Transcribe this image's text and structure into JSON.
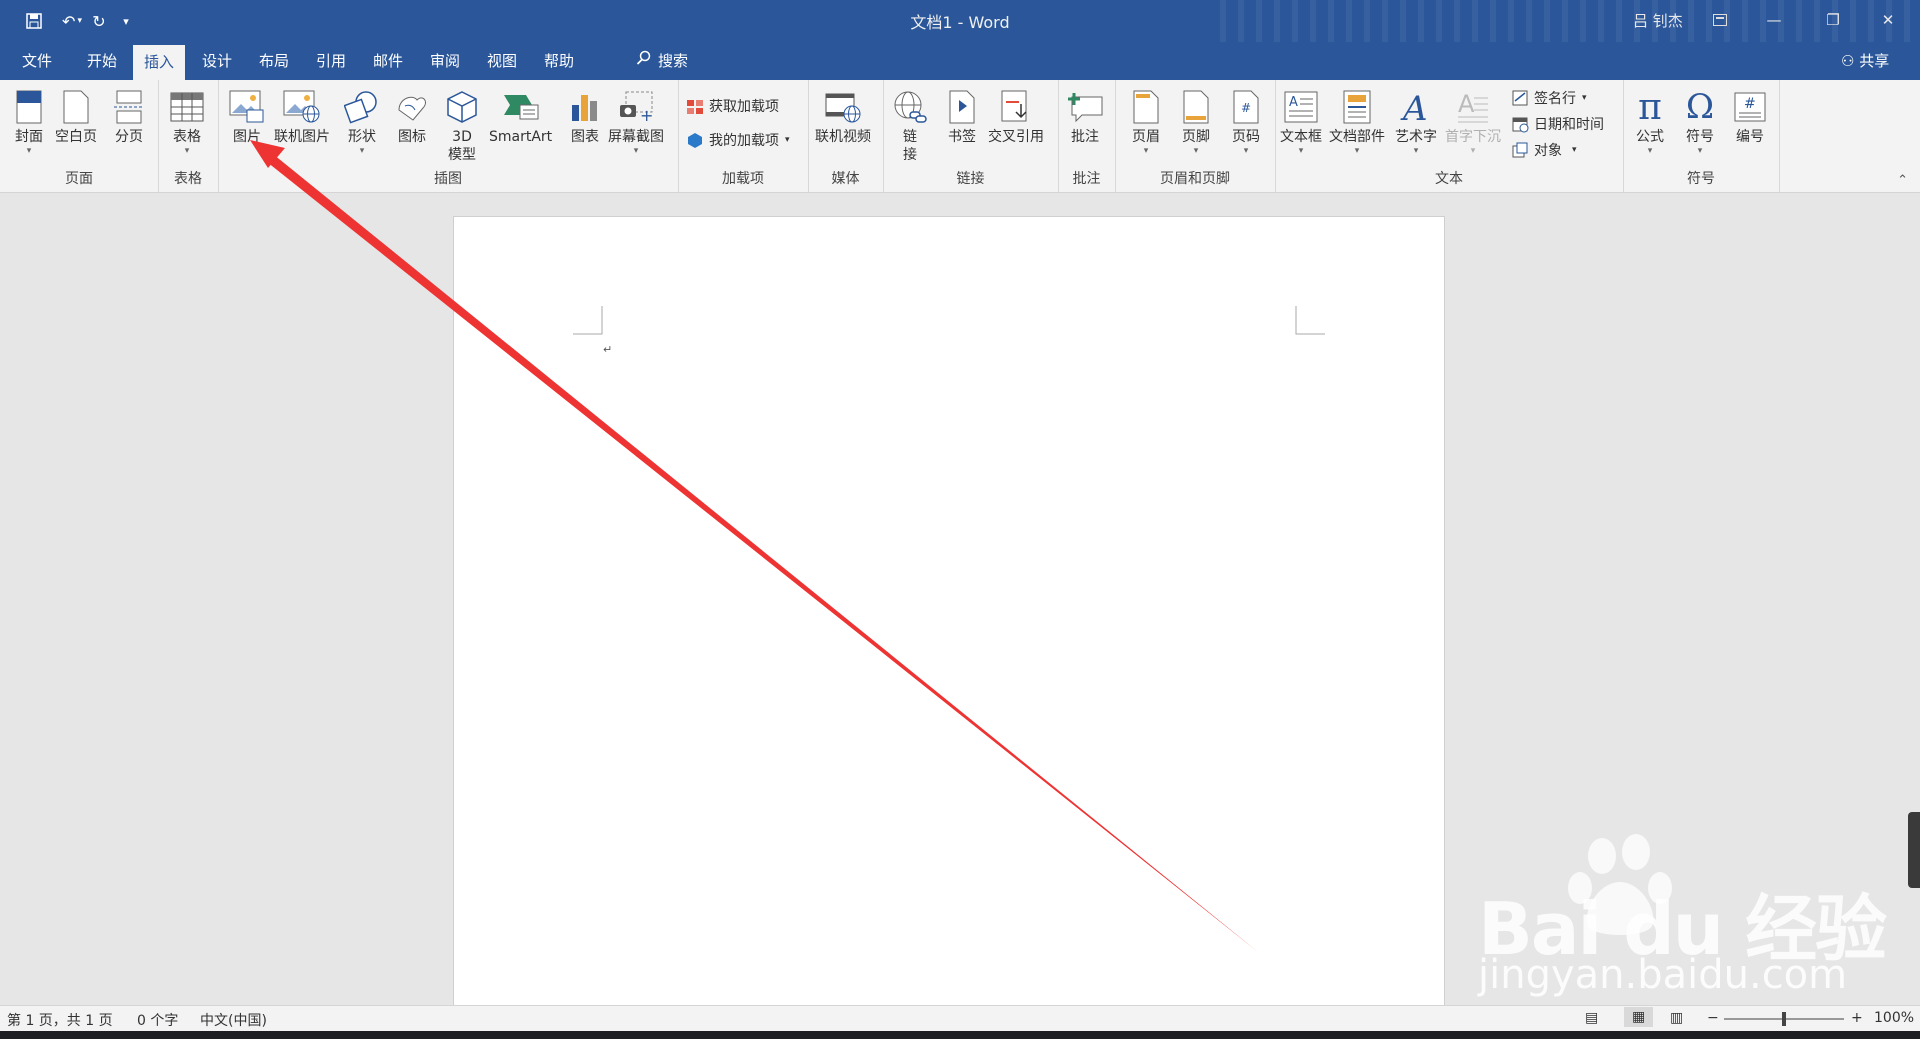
{
  "window": {
    "title": "文档1 - Word",
    "user": "吕 钊杰",
    "share_label": "共享"
  },
  "quick_access": {
    "icons": [
      "save-icon",
      "undo-icon",
      "redo-icon",
      "customize-icon"
    ]
  },
  "tabs": [
    {
      "label": "文件"
    },
    {
      "label": "开始"
    },
    {
      "label": "插入",
      "active": true
    },
    {
      "label": "设计"
    },
    {
      "label": "布局"
    },
    {
      "label": "引用"
    },
    {
      "label": "邮件"
    },
    {
      "label": "审阅"
    },
    {
      "label": "视图"
    },
    {
      "label": "帮助"
    }
  ],
  "search_label": "搜索",
  "ribbon": {
    "groups": {
      "pages": {
        "label": "页面",
        "buttons": [
          "封面",
          "空白页",
          "分页"
        ]
      },
      "tables": {
        "label": "表格",
        "buttons": [
          "表格"
        ]
      },
      "illustrations": {
        "label": "插图",
        "buttons": [
          "图片",
          "联机图片",
          "形状",
          "图标",
          "3D",
          "模型",
          "SmartArt",
          "图表",
          "屏幕截图"
        ]
      },
      "addins": {
        "label": "加载项",
        "buttons": [
          "获取加载项",
          "我的加载项"
        ]
      },
      "media": {
        "label": "媒体",
        "buttons": [
          "联机视频"
        ]
      },
      "links": {
        "label": "链接",
        "buttons": [
          "链",
          "接",
          "书签",
          "交叉引用"
        ]
      },
      "comments": {
        "label": "批注",
        "buttons": [
          "批注"
        ]
      },
      "header_footer": {
        "label": "页眉和页脚",
        "buttons": [
          "页眉",
          "页脚",
          "页码"
        ]
      },
      "text": {
        "label": "文本",
        "buttons": [
          "文本框",
          "文档部件",
          "艺术字",
          "首字下沉",
          "签名行",
          "日期和时间",
          "对象"
        ]
      },
      "symbols": {
        "label": "符号",
        "buttons": [
          "公式",
          "符号",
          "编号"
        ]
      }
    }
  },
  "document": {
    "paragraph_mark": "↵"
  },
  "status": {
    "page": "第 1 页，共 1 页",
    "words": "0 个字",
    "language": "中文(中国)",
    "zoom": "100%",
    "zoom_level": 1.0
  },
  "watermark": {
    "brand": "Bai du 经验",
    "url": "jingyan.baidu.com"
  },
  "colors": {
    "accent": "#2b579a",
    "annotation_arrow": "#ee3333"
  }
}
